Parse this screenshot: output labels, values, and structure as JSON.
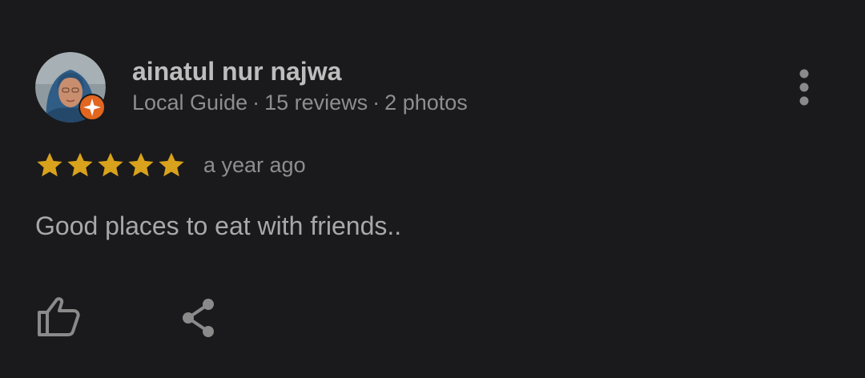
{
  "review": {
    "reviewer": {
      "name": "ainatul nur najwa",
      "role": "Local Guide",
      "reviews": "15 reviews",
      "photos": "2 photos",
      "separator": "·"
    },
    "rating": 5,
    "rating_max": 5,
    "date": "a year ago",
    "text": "Good places to eat with friends..",
    "actions": {
      "more_icon": "more-vert-icon",
      "like_icon": "thumb-up-icon",
      "share_icon": "share-icon"
    },
    "colors": {
      "background": "#1a1a1c",
      "star": "#d8a21c",
      "badge": "#e2661f",
      "icon": "#8a8a8a"
    }
  }
}
